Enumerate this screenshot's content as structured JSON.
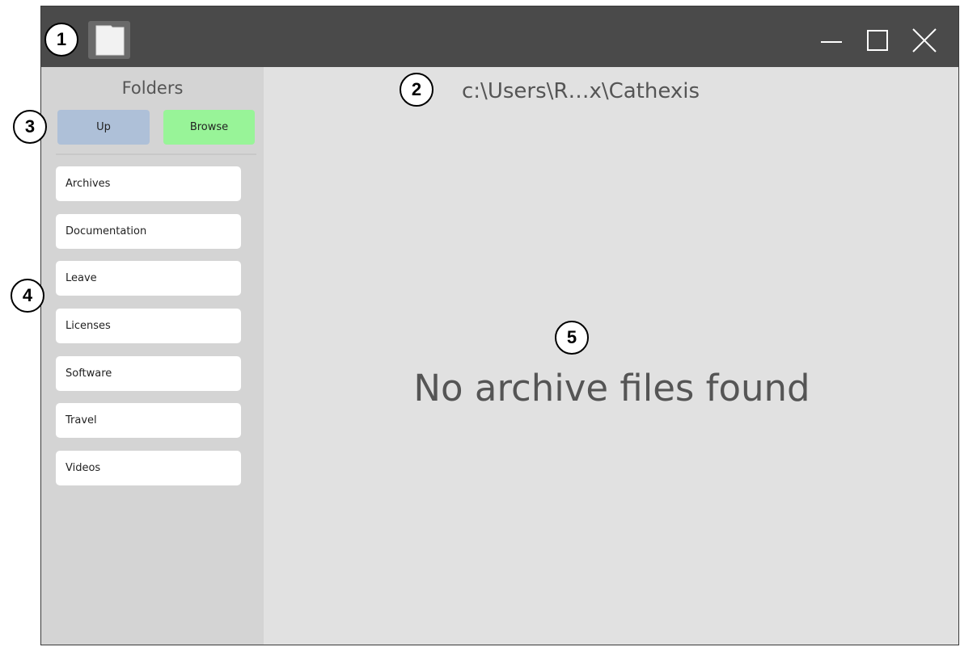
{
  "titlebar": {
    "app_icon": "folder-icon",
    "controls": [
      "minimize-icon",
      "maximize-icon",
      "close-icon"
    ]
  },
  "sidebar": {
    "title": "Folders",
    "up_label": "Up",
    "browse_label": "Browse",
    "items": [
      {
        "label": "Archives"
      },
      {
        "label": "Documentation"
      },
      {
        "label": "Leave"
      },
      {
        "label": "Licenses"
      },
      {
        "label": "Software"
      },
      {
        "label": "Travel"
      },
      {
        "label": "Videos"
      }
    ]
  },
  "main": {
    "path": "c:\\Users\\R…x\\Cathexis",
    "empty_message": "No archive files found"
  },
  "callouts": [
    "1",
    "2",
    "3",
    "4",
    "5"
  ],
  "colors": {
    "titlebar": "#4a4a4a",
    "up_button": "#aec0d8",
    "browse_button": "#98f498",
    "sidebar": "#d4d4d4",
    "main": "#e1e1e1"
  }
}
